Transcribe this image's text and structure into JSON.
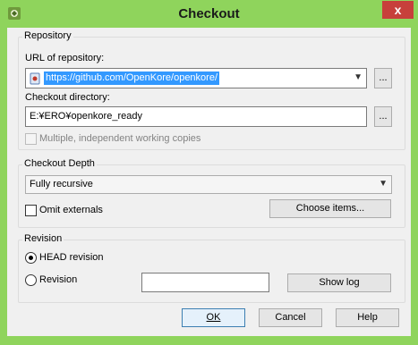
{
  "window": {
    "title": "Checkout",
    "close_glyph": "x"
  },
  "repository": {
    "group_label": "Repository",
    "url_label": "URL of repository:",
    "url_value": "https://github.com/OpenKore/openkore/",
    "url_browse_label": "...",
    "dir_label": "Checkout directory:",
    "dir_value": "E:¥ERO¥openkore_ready",
    "dir_browse_label": "...",
    "multiple_wc_label": "Multiple, independent working copies",
    "multiple_wc_checked": false
  },
  "depth": {
    "group_label": "Checkout Depth",
    "selected": "Fully recursive",
    "omit_externals_label": "Omit externals",
    "omit_externals_checked": false,
    "choose_items_label": "Choose items..."
  },
  "revision": {
    "group_label": "Revision",
    "head_label": "HEAD revision",
    "head_selected": true,
    "revision_label": "Revision",
    "revision_value": "",
    "show_log_label": "Show log"
  },
  "footer": {
    "ok_label": "OK",
    "cancel_label": "Cancel",
    "help_label": "Help"
  },
  "colors": {
    "frame": "#8fd45c",
    "close": "#c7403b",
    "selection": "#3399ff",
    "dialog": "#f0f0f0"
  }
}
